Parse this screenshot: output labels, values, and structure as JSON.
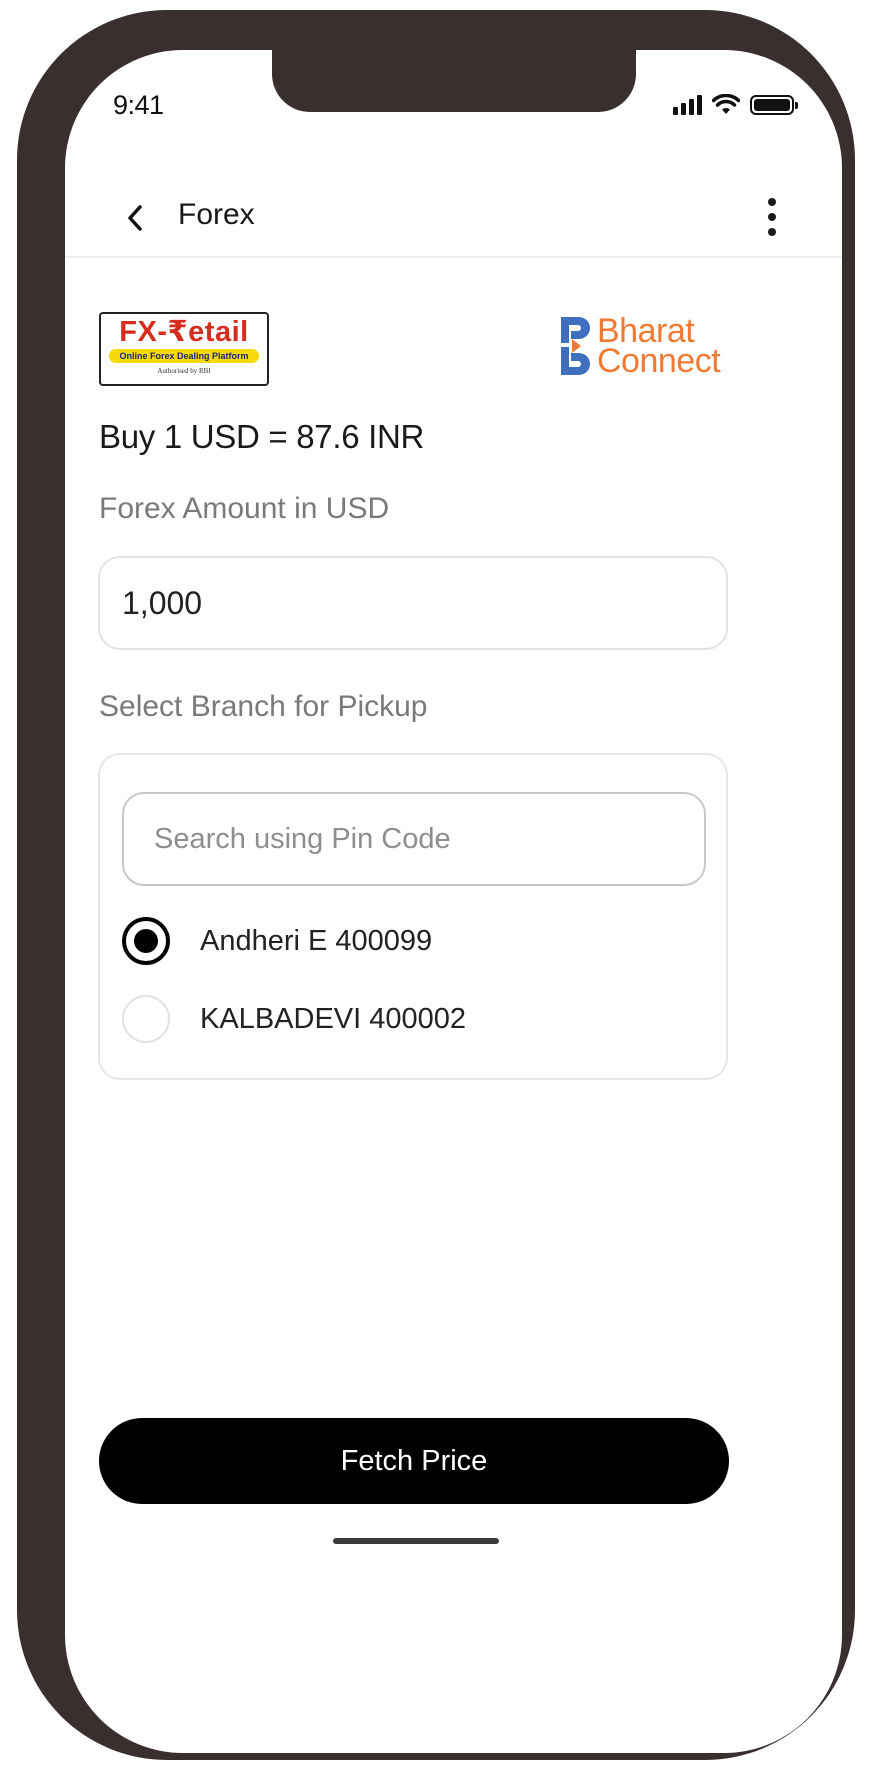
{
  "status_bar": {
    "time": "9:41"
  },
  "header": {
    "title": "Forex"
  },
  "logos": {
    "fx_retail": {
      "main": "FX-₹etail",
      "tagline": "Online Forex Dealing Platform",
      "authorised": "Authorised by RBI"
    },
    "bharat_connect": {
      "line1": "Bharat",
      "line2": "Connect",
      "color": "#ef7a33",
      "mark_color": "#3f6fbf"
    }
  },
  "rate": {
    "text": "Buy 1 USD = 87.6 INR"
  },
  "forex_amount": {
    "label": "Forex Amount in USD",
    "value": "1,000"
  },
  "branch": {
    "label": "Select Branch for Pickup",
    "search_placeholder": "Search using Pin Code",
    "options": [
      {
        "label": "Andheri E 400099",
        "selected": true
      },
      {
        "label": "KALBADEVI 400002",
        "selected": false
      }
    ]
  },
  "actions": {
    "fetch_label": "Fetch Price"
  },
  "icons": {
    "back": "chevron-left-icon",
    "more": "more-vertical-icon",
    "signal": "cellular-signal-icon",
    "wifi": "wifi-icon",
    "battery": "battery-icon"
  }
}
